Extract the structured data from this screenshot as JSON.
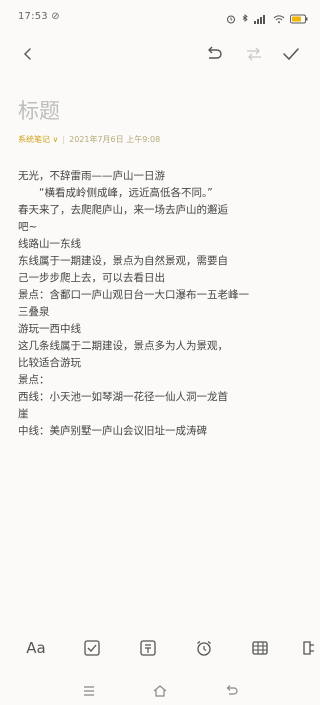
{
  "status_bar": {
    "time": "17:53 ⊘",
    "battery_color": "#f2b705"
  },
  "toolbar": {
    "back_icon": "chevron-left-icon",
    "undo_icon": "undo-icon",
    "redo_icon": "redo-icon",
    "done_icon": "check-icon"
  },
  "note": {
    "title": "标题",
    "folder": "系统笔记",
    "date": "2021年7月6日 上午9:08",
    "lines": [
      "无光，不辞雷雨——庐山一日游",
      "　　“横看成岭侧成峰，远近高低各不同。”",
      "春天来了，去爬爬庐山，来一场去庐山的邂逅",
      "吧~",
      "线路山一东线",
      "东线属于一期建设，景点为自然景观，需要自",
      "己一步步爬上去，可以去看日出",
      "景点：含鄱口一庐山观日台一大口瀑布一五老峰一",
      "三叠泉",
      "游玩一西中线",
      "这几条线属于二期建设，景点多为人为景观，",
      "比较适合游玩",
      "景点：",
      "西线：小天池一如琴湖一花径一仙人洞一龙首",
      "崖",
      "中线：美庐别墅一庐山会议旧址一成涛碑"
    ]
  },
  "bottom_tools": {
    "font_label": "Aa",
    "checklist_icon": "checklist-icon",
    "image_icon": "image-icon",
    "alarm_icon": "alarm-clock-icon",
    "table_icon": "table-icon",
    "share_icon": "share-icon"
  },
  "nav_bar": {
    "menu_icon": "menu-icon",
    "home_icon": "home-icon",
    "back_icon": "back-icon"
  }
}
